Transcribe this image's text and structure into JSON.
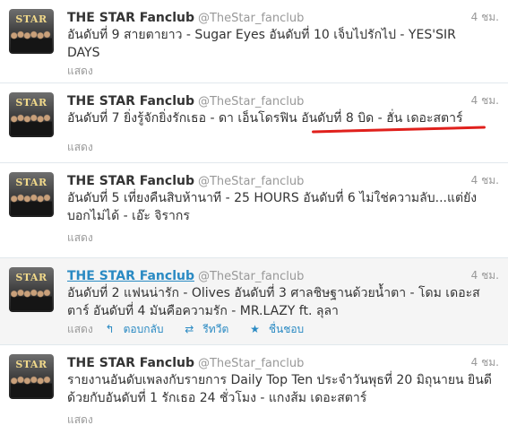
{
  "tweets": [
    {
      "name": "THE STAR Fanclub",
      "handle": "@TheStar_fanclub",
      "time": "4 ชม.",
      "text": "อันดับที่ 9 สายตายาว - Sugar Eyes อันดับที่ 10 เจ็บไปรักไป - YES'SIR DAYS",
      "expand": "แสดง",
      "avatar_logo": "STAR"
    },
    {
      "name": "THE STAR Fanclub",
      "handle": "@TheStar_fanclub",
      "time": "4 ชม.",
      "text_before": "อันดับที่ 7 ยิ่งรู้จักยิ่งรักเธอ - ดา เอ็นโดรฟิน ",
      "text_highlight": "อันดับที่ 8 บิด - ฮั่น เดอะสตาร์",
      "expand": "แสดง",
      "avatar_logo": "STAR"
    },
    {
      "name": "THE STAR Fanclub",
      "handle": "@TheStar_fanclub",
      "time": "4 ชม.",
      "text": "อันดับที่ 5 เที่ยงคืนสิบห้านาที - 25 HOURS อันดับที่ 6 ไม่ใช่ความลับ...แต่ยังบอกไม่ได้ - เอ๊ะ จิรากร",
      "expand": "แสดง",
      "avatar_logo": "STAR"
    },
    {
      "name": "THE STAR Fanclub",
      "handle": "@TheStar_fanclub",
      "time": "4 ชม.",
      "text": "อันดับที่ 2 แฟนน่ารัก - Olives อันดับที่ 3 ศาลชิษฐานด้วยน้ำตา - โดม เดอะสตาร์ อันดับที่ 4 มันคือความรัก - MR.LAZY ft. ลุลา",
      "expand": "แสดง",
      "reply": "ตอบกลับ",
      "retweet": "รีทวีต",
      "favorite": "ชื่นชอบ",
      "avatar_logo": "STAR"
    },
    {
      "name": "THE STAR Fanclub",
      "handle": "@TheStar_fanclub",
      "time": "4 ชม.",
      "text": "รายงานอันดับเพลงกับรายการ Daily Top Ten ประจำวันพุธที่ 20 มิถุนายน ยินดีด้วยกับอันดับที่ 1 รักเธอ 24 ชั่วโมง - แกงส้ม เดอะสตาร์",
      "expand": "แสดง",
      "avatar_logo": "STAR"
    }
  ],
  "colors": {
    "link": "#2a8ac3",
    "annotation": "#e0201c",
    "hover_bg": "#f5f5f5",
    "muted": "#999999"
  },
  "icons": [
    "reply-icon",
    "retweet-icon",
    "star-icon"
  ]
}
